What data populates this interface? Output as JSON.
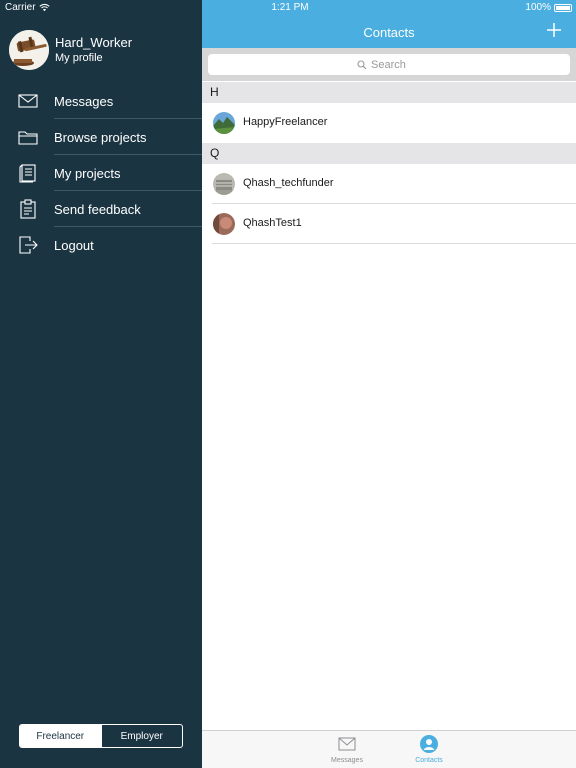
{
  "status": {
    "carrier": "Carrier",
    "time": "1:21 PM",
    "battery": "100%"
  },
  "sidebar": {
    "profile": {
      "name": "Hard_Worker",
      "subtitle": "My profile"
    },
    "items": [
      {
        "label": "Messages",
        "icon": "envelope-icon"
      },
      {
        "label": "Browse projects",
        "icon": "folder-icon"
      },
      {
        "label": "My projects",
        "icon": "document-icon"
      },
      {
        "label": "Send feedback",
        "icon": "clipboard-icon"
      },
      {
        "label": "Logout",
        "icon": "logout-icon"
      }
    ],
    "roles": {
      "active": "Freelancer",
      "inactive": "Employer"
    }
  },
  "navbar": {
    "title": "Contacts"
  },
  "search": {
    "placeholder": "Search"
  },
  "contacts": {
    "sections": [
      {
        "letter": "H",
        "items": [
          "HappyFreelancer"
        ]
      },
      {
        "letter": "Q",
        "items": [
          "Qhash_techfunder",
          "QhashTest1"
        ]
      }
    ]
  },
  "tabbar": {
    "tabs": [
      {
        "label": "Messages",
        "icon": "envelope-icon",
        "active": false
      },
      {
        "label": "Contacts",
        "icon": "person-icon",
        "active": true
      }
    ]
  },
  "colors": {
    "sidebar_bg": "#1b3442",
    "accent": "#4aaee0",
    "section_bg": "#e5e5e8",
    "tab_inactive": "#8e8e93"
  }
}
